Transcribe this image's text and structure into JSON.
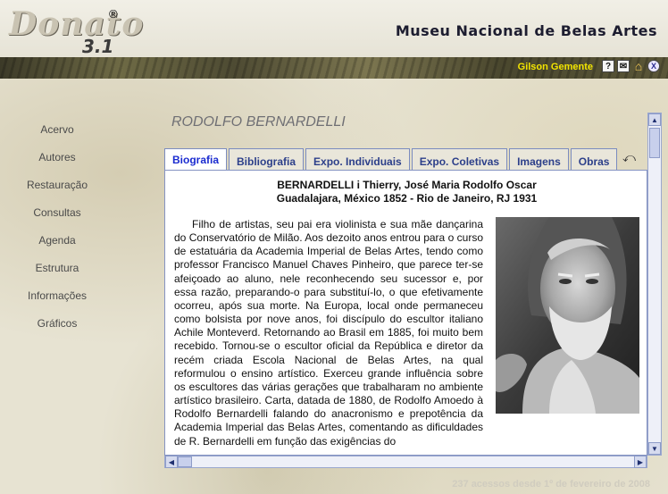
{
  "header": {
    "logo_text": "Donato",
    "logo_version": "3.1",
    "logo_reg": "®",
    "museum_name": "Museu Nacional de Belas Artes",
    "user_name": "Gilson Gemente",
    "icons": [
      "help-icon",
      "mail-icon",
      "home-icon",
      "exit-icon"
    ],
    "help_glyph": "?",
    "mail_glyph": "✉",
    "home_glyph": "⌂",
    "exit_glyph": "X"
  },
  "nav": {
    "items": [
      {
        "label": "Acervo"
      },
      {
        "label": "Autores"
      },
      {
        "label": "Restauração"
      },
      {
        "label": "Consultas"
      },
      {
        "label": "Agenda"
      },
      {
        "label": "Estrutura"
      },
      {
        "label": "Informações"
      },
      {
        "label": "Gráficos"
      }
    ]
  },
  "main": {
    "artist_title": "RODOLFO BERNARDELLI",
    "tabs": [
      {
        "label": "Biografia",
        "active": true
      },
      {
        "label": "Bibliografia"
      },
      {
        "label": "Expo. Individuais"
      },
      {
        "label": "Expo. Coletivas"
      },
      {
        "label": "Imagens"
      },
      {
        "label": "Obras"
      }
    ],
    "back_glyph": "⤺",
    "bio": {
      "heading_line1": "BERNARDELLI i Thierry, José Maria Rodolfo Oscar",
      "heading_line2": "Guadalajara, México 1852 - Rio de Janeiro, RJ 1931",
      "text": "Filho de artistas, seu pai era violinista e sua mãe dançarina do Conservatório de Milão. Aos dezoito anos entrou para o curso de estatuária da Academia Imperial de Belas Artes, tendo como professor Francisco Manuel Chaves Pinheiro, que parece ter-se afeiçoado ao aluno, nele reconhecendo seu sucessor e, por essa razão, preparando-o para substituí-lo, o que efetivamente ocorreu, após sua morte. Na Europa, local onde permaneceu como bolsista por nove anos, foi discípulo do escultor italiano Achile Monteverd. Retornando ao Brasil em 1885, foi muito bem recebido. Tornou-se o escultor oficial da República e diretor da recém criada Escola Nacional de Belas Artes, na qual reformulou o ensino artístico. Exerceu grande influência sobre os escultores das várias gerações que trabalharam no ambiente artístico brasileiro. Carta, datada de 1880, de Rodolfo Amoedo à Rodolfo Bernardelli falando do anacronismo e prepotência da Academia Imperial das Belas Artes, comentando as dificuldades de R. Bernardelli em função das exigências do"
    }
  },
  "scroll": {
    "up": "▲",
    "down": "▼",
    "left": "◀",
    "right": "▶"
  },
  "footer": {
    "text": "237 acessos desde 1º de fevereiro de 2008"
  }
}
